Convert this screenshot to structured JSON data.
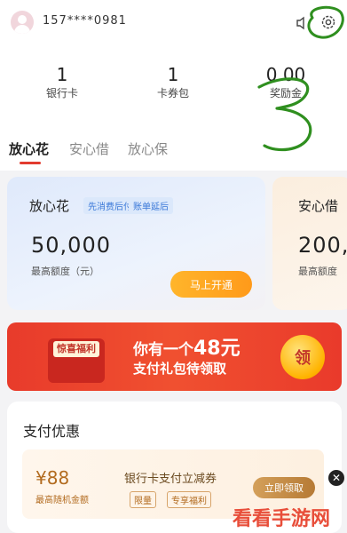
{
  "header": {
    "phone": "157****0981",
    "icons": [
      "avatar-icon",
      "speaker-icon",
      "gear-icon"
    ]
  },
  "stats": [
    {
      "value": "1",
      "label": "银行卡"
    },
    {
      "value": "1",
      "label": "卡券包"
    },
    {
      "value": "0.00",
      "label": "奖励金"
    }
  ],
  "tabs": [
    "放心花",
    "安心借",
    "放心保"
  ],
  "cards": {
    "primary": {
      "title": "放心花",
      "tags": [
        "先消费后付",
        "账单延后"
      ],
      "amount": "50,000",
      "amount_label": "最高额度（元）",
      "button": "马上开通"
    },
    "secondary": {
      "title": "安心借",
      "amount": "200,",
      "amount_label": "最高额度"
    }
  },
  "banner": {
    "tag": "惊喜福利",
    "line1_prefix": "你有一个",
    "line1_amount": "48元",
    "line2": "支付礼包待领取",
    "button": "领"
  },
  "payment": {
    "title": "支付优惠",
    "amount": "¥88",
    "amount_label": "最高随机金额",
    "headline": "银行卡支付立减券",
    "tags": [
      "限量",
      "专享福利"
    ],
    "button": "立即领取"
  },
  "watermark": "看看手游网",
  "colors": {
    "accent_red": "#e23b2f",
    "orange_button": "#ff9a1a",
    "annotation_green": "#2f8f1f"
  }
}
